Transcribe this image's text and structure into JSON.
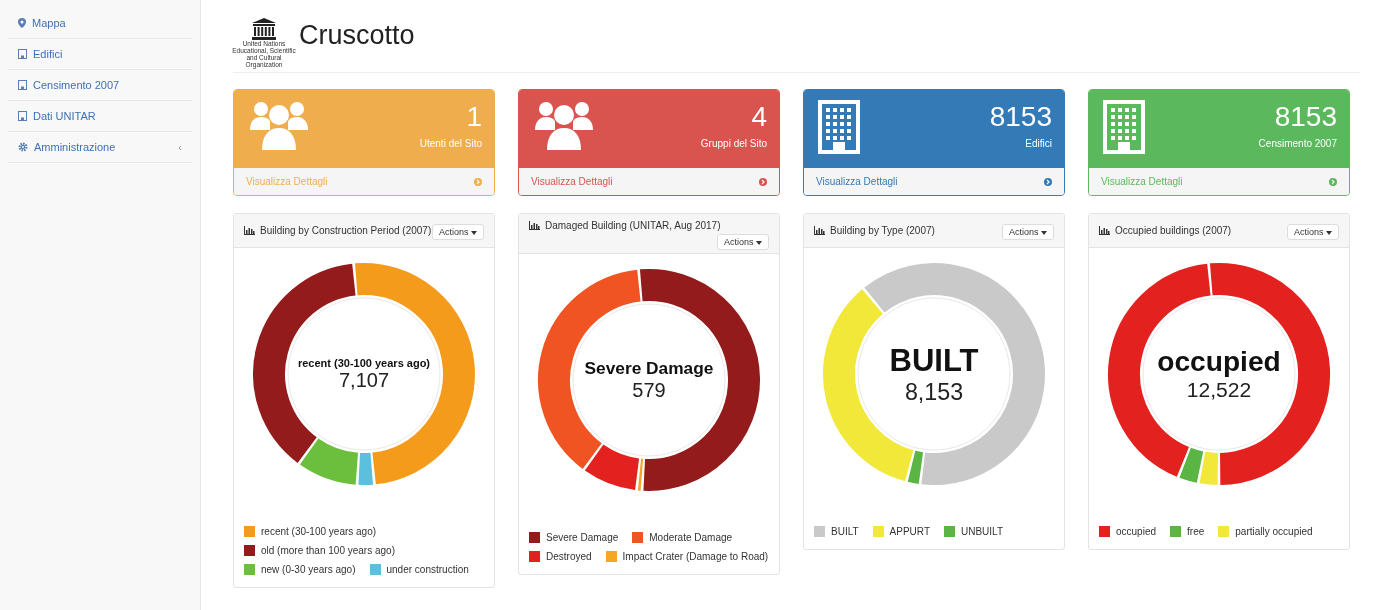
{
  "sidebar": {
    "items": [
      {
        "label": "Mappa",
        "kind": "pin"
      },
      {
        "label": "Edifici",
        "kind": "building"
      },
      {
        "label": "Censimento 2007",
        "kind": "building"
      },
      {
        "label": "Dati UNITAR",
        "kind": "building"
      },
      {
        "label": "Amministrazione",
        "kind": "gear",
        "expander": "‹"
      }
    ]
  },
  "header": {
    "logo_caption": "United Nations Educational, Scientific and Cultural Organization",
    "title": "Cruscotto"
  },
  "stats": [
    {
      "value": "1",
      "label": "Utenti del Sito",
      "link": "Visualizza Dettagli",
      "color": "#f0ad4e",
      "kind": "users"
    },
    {
      "value": "4",
      "label": "Gruppi del Sito",
      "link": "Visualizza Dettagli",
      "color": "#d9534f",
      "kind": "users"
    },
    {
      "value": "8153",
      "label": "Edifici",
      "link": "Visualizza Dettagli",
      "color": "#337ab7",
      "kind": "building"
    },
    {
      "value": "8153",
      "label": "Censimento 2007",
      "link": "Visualizza Dettagli",
      "color": "#5cb85c",
      "kind": "building"
    }
  ],
  "charts": [
    {
      "title": "Building by Construction Period (2007)",
      "actions": "Actions",
      "center_label": "recent (30-100 years ago)",
      "center_value": "7,107",
      "legend": [
        {
          "label": "recent (30-100 years ago)",
          "color": "#f59b1c"
        },
        {
          "label": "old (more than 100 years ago)",
          "color": "#931b1b"
        },
        {
          "label": "new (0-30 years ago)",
          "color": "#6cbf3c"
        },
        {
          "label": "under construction",
          "color": "#5bc0de"
        }
      ]
    },
    {
      "title": "Damaged Building (UNITAR, Aug 2017)",
      "actions": "Actions",
      "center_label": "Severe Damage",
      "center_value": "579",
      "legend": [
        {
          "label": "Severe Damage",
          "color": "#931b1b"
        },
        {
          "label": "Moderate Damage",
          "color": "#ef5422"
        },
        {
          "label": "Destroyed",
          "color": "#e3211f"
        },
        {
          "label": "Impact Crater (Damage to Road)",
          "color": "#f5a623"
        }
      ]
    },
    {
      "title": "Building by Type (2007)",
      "actions": "Actions",
      "center_label": "BUILT",
      "center_value": "8,153",
      "legend": [
        {
          "label": "BUILT",
          "color": "#c9c9c9"
        },
        {
          "label": "APPURT",
          "color": "#f2e83a"
        },
        {
          "label": "UNBUILT",
          "color": "#5ab544"
        }
      ]
    },
    {
      "title": "Occupied buildings (2007)",
      "actions": "Actions",
      "center_label": "occupied",
      "center_value": "12,522",
      "legend": [
        {
          "label": "occupied",
          "color": "#e3211f"
        },
        {
          "label": "free",
          "color": "#5ab544"
        },
        {
          "label": "partially occupied",
          "color": "#f2e83a"
        }
      ]
    }
  ]
}
